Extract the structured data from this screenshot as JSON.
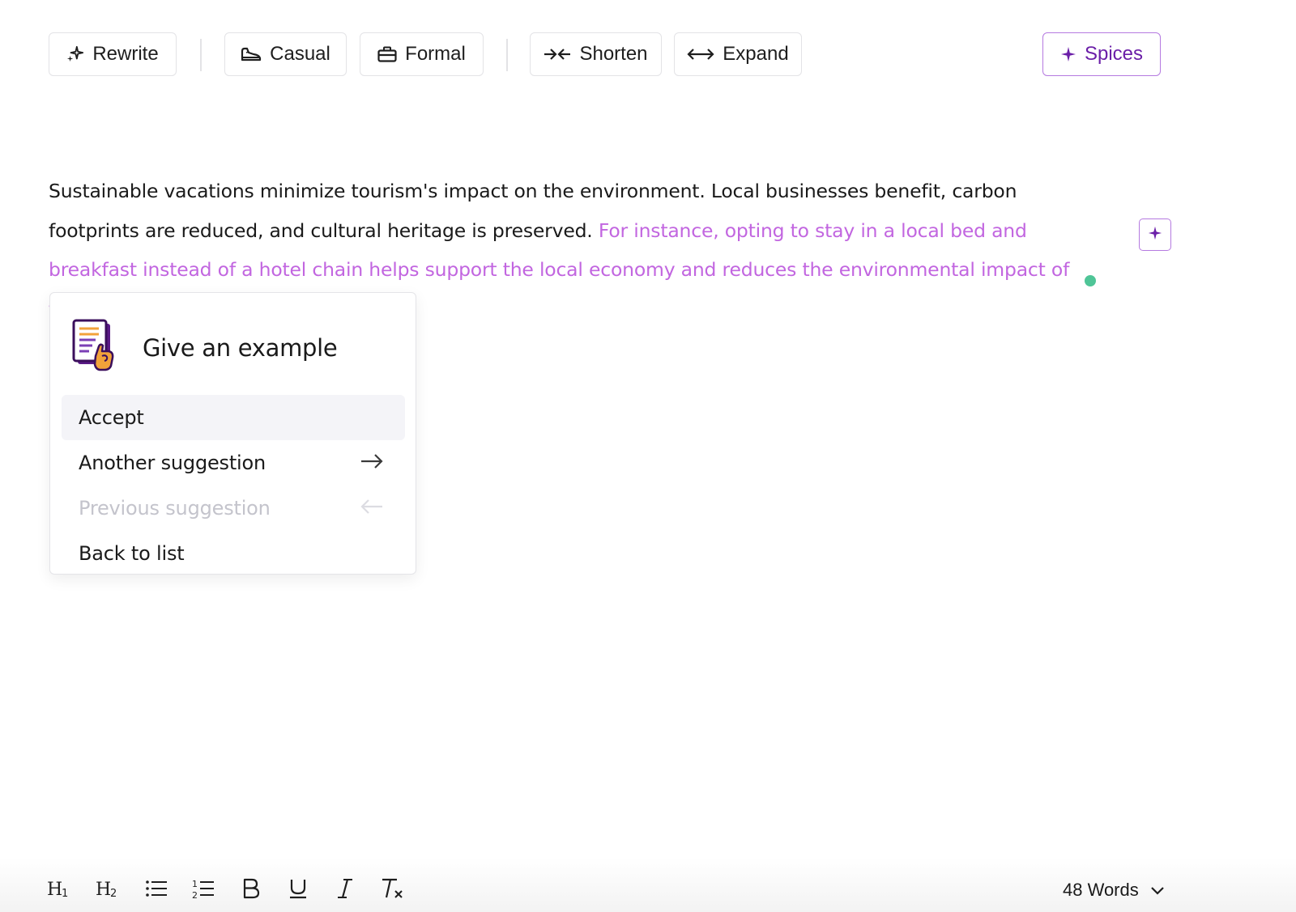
{
  "toolbar": {
    "rewrite_label": "Rewrite",
    "casual_label": "Casual",
    "formal_label": "Formal",
    "shorten_label": "Shorten",
    "expand_label": "Expand",
    "spices_label": "Spices"
  },
  "editor": {
    "original_text": "Sustainable vacations minimize tourism's impact on the environment. Local businesses benefit, carbon footprints are reduced, and cultural heritage is preserved.",
    "suggested_text": "For instance, opting to stay in a local bed and breakfast instead of a hotel chain helps support the local economy and reduces the environmental impact of traveling."
  },
  "popup": {
    "title": "Give an example",
    "items": [
      {
        "label": "Accept",
        "active": true
      },
      {
        "label": "Another suggestion",
        "arrow": "right-arrow-icon"
      },
      {
        "label": "Previous suggestion",
        "arrow": "left-arrow-icon",
        "disabled": true
      },
      {
        "label": "Back to list"
      }
    ]
  },
  "formatbar": {
    "word_count_label": "48 Words"
  },
  "colors": {
    "accent": "#6b1fa8",
    "suggestion_text": "#c266e0",
    "status_dot": "#4fc597",
    "border": "#e3e3e6"
  }
}
